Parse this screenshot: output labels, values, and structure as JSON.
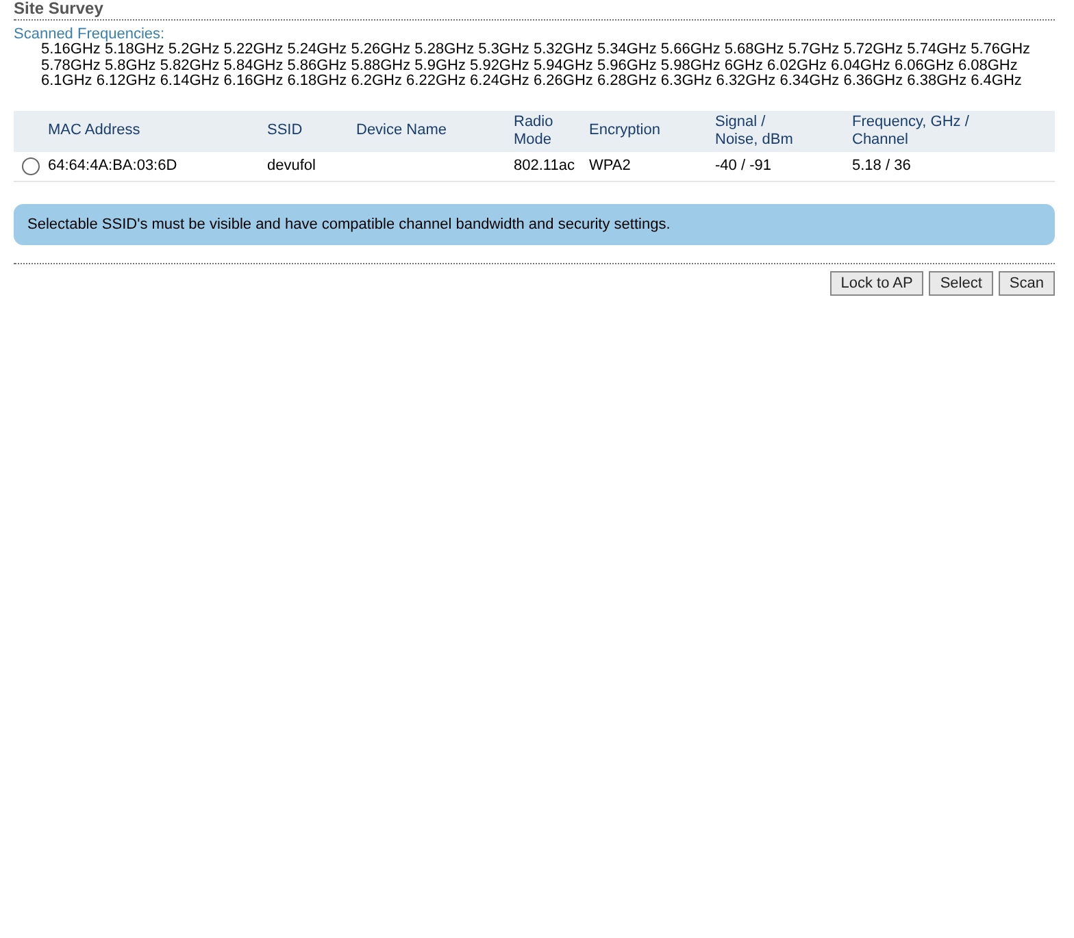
{
  "title": "Site Survey",
  "scanned_frequencies": {
    "label": "Scanned Frequencies:",
    "lines": [
      "5.16GHz 5.18GHz 5.2GHz 5.22GHz 5.24GHz 5.26GHz 5.28GHz 5.3GHz 5.32GHz 5.34GHz 5.66GHz 5.68GHz 5.7GHz 5.72GHz 5.74GHz 5.76GHz",
      "5.78GHz 5.8GHz 5.82GHz 5.84GHz 5.86GHz 5.88GHz 5.9GHz 5.92GHz 5.94GHz 5.96GHz 5.98GHz 6GHz 6.02GHz 6.04GHz 6.06GHz 6.08GHz",
      "6.1GHz 6.12GHz 6.14GHz 6.16GHz 6.18GHz 6.2GHz 6.22GHz 6.24GHz 6.26GHz 6.28GHz 6.3GHz 6.32GHz 6.34GHz 6.36GHz 6.38GHz 6.4GHz"
    ]
  },
  "table": {
    "columns": [
      "MAC Address",
      "SSID",
      "Device Name",
      "Radio Mode",
      "Encryption",
      "Signal / Noise, dBm",
      "Frequency, GHz / Channel"
    ],
    "rows": [
      {
        "selected": false,
        "cells": [
          "64:64:4A:BA:03:6D",
          "devufol",
          "",
          "802.11ac",
          "WPA2",
          "-40 / -91",
          "5.18 / 36"
        ]
      }
    ]
  },
  "notice": "Selectable SSID's must be visible and have compatible channel bandwidth and security settings.",
  "buttons": [
    "Lock to AP",
    "Select",
    "Scan"
  ]
}
